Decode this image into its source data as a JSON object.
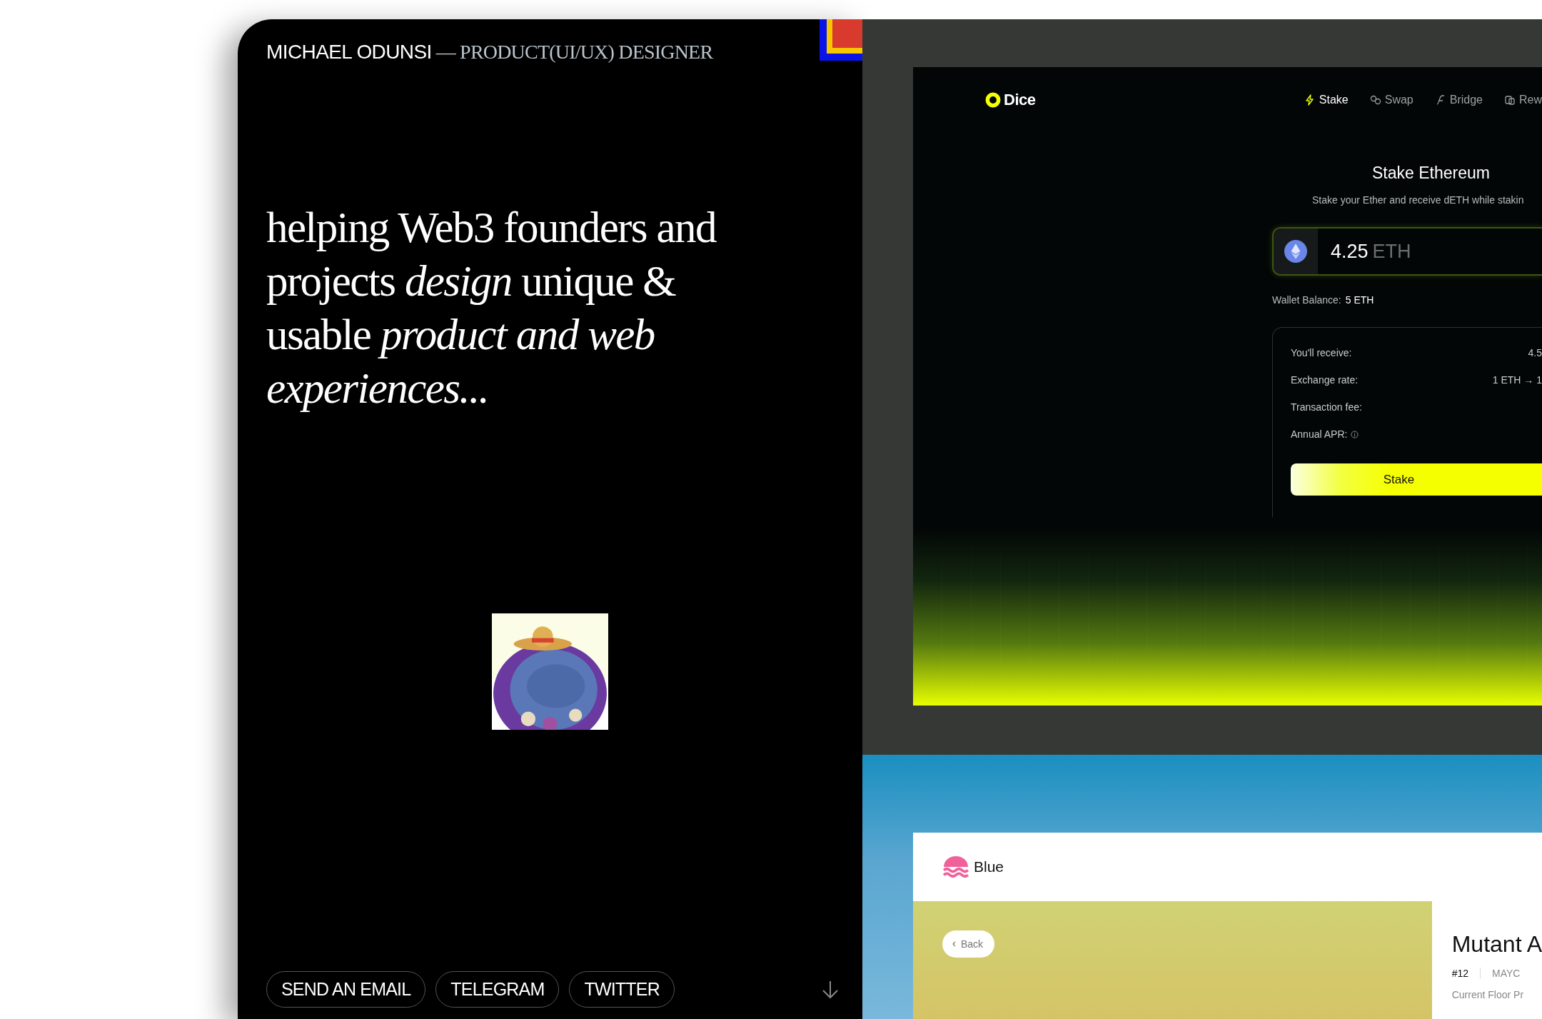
{
  "header": {
    "name": "MICHAEL ODUNSI",
    "role": "— PRODUCT(UI/UX) DESIGNER"
  },
  "hero": {
    "text": "helping Web3 founders and projects *design* unique & usable *product and web experiences...*"
  },
  "links": [
    {
      "label": "SEND AN EMAIL"
    },
    {
      "label": "TELEGRAM"
    },
    {
      "label": "TWITTER"
    }
  ],
  "dice_preview": {
    "logo": "Dice",
    "nav": [
      {
        "label": "Stake",
        "selected": true
      },
      {
        "label": "Swap",
        "selected": false
      },
      {
        "label": "Bridge",
        "selected": false
      },
      {
        "label": "Rew",
        "selected": false
      }
    ],
    "title": "Stake Ethereum",
    "subtitle": "Stake your Ether and receive dETH while stakin",
    "amount": "4.25",
    "unit": "ETH",
    "balance_label": "Wallet Balance:",
    "balance": "5 ETH",
    "details": [
      {
        "label": "You'll receive:",
        "value": "4.5"
      },
      {
        "label": "Exchange rate:",
        "value": "1 ETH → 1"
      },
      {
        "label": "Transaction fee:"
      },
      {
        "label": "Annual APR:",
        "info": true
      }
    ],
    "button": "Stake"
  },
  "blue_preview": {
    "logo": "Blue",
    "back": "Back",
    "title": "Mutant A",
    "tags": [
      "#12",
      "MAYC"
    ],
    "floor_label": "Current Floor Pr"
  }
}
